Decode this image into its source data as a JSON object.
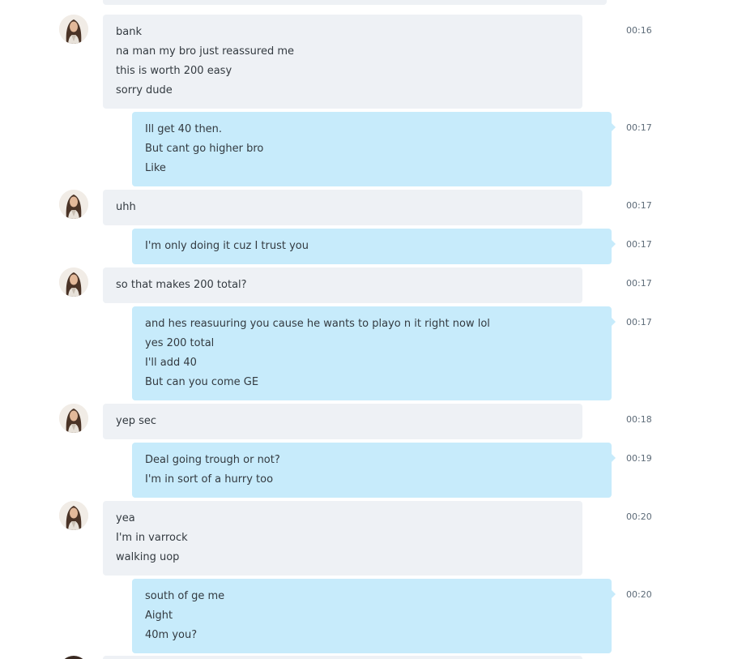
{
  "contact": {
    "avatar_icon": "contact-avatar-icon"
  },
  "messages": [
    {
      "direction": "in",
      "time": "00:16",
      "lines": [
        "bank",
        "na man my bro just reassured me",
        "this is worth 200 easy",
        "sorry dude"
      ]
    },
    {
      "direction": "out",
      "time": "00:17",
      "lines": [
        "Ill get 40 then.",
        "But cant go higher bro",
        "Like"
      ]
    },
    {
      "direction": "in",
      "time": "00:17",
      "lines": [
        "uhh"
      ]
    },
    {
      "direction": "out",
      "time": "00:17",
      "lines": [
        "I'm only doing it cuz I trust you"
      ]
    },
    {
      "direction": "in",
      "time": "00:17",
      "lines": [
        "so that makes 200 total?"
      ]
    },
    {
      "direction": "out",
      "time": "00:17",
      "lines": [
        "and hes reasuuring you cause he wants to playo n it right now lol",
        "yes 200 total",
        "I'll add 40",
        "But can you come GE"
      ]
    },
    {
      "direction": "in",
      "time": "00:18",
      "lines": [
        "yep sec"
      ]
    },
    {
      "direction": "out",
      "time": "00:19",
      "lines": [
        "Deal going trough or not?",
        "I'm in sort of a hurry too"
      ]
    },
    {
      "direction": "in",
      "time": "00:20",
      "lines": [
        "yea",
        "I'm in varrock",
        "walking uop"
      ]
    },
    {
      "direction": "out",
      "time": "00:20",
      "lines": [
        "south of ge me",
        "Aight",
        "40m you?"
      ]
    }
  ],
  "colors": {
    "incoming_bubble": "#eef1f5",
    "outgoing_bubble": "#c7ebfb",
    "timestamp": "#5d6b78",
    "text": "#333a40"
  }
}
